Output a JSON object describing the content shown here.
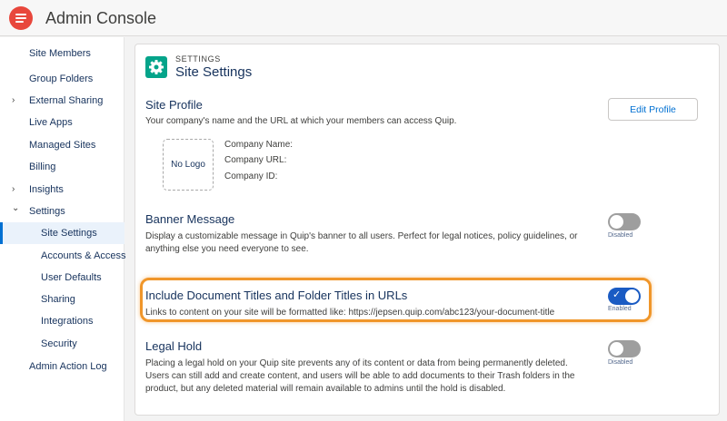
{
  "app": {
    "title": "Admin Console"
  },
  "sidebar": {
    "items": [
      {
        "label": "Site Members"
      },
      {
        "label": "Group Folders"
      },
      {
        "label": "External Sharing",
        "chevron": "›"
      },
      {
        "label": "Live Apps"
      },
      {
        "label": "Managed Sites"
      },
      {
        "label": "Billing"
      },
      {
        "label": "Insights",
        "chevron": "›"
      },
      {
        "label": "Settings",
        "chevron": "⌄"
      },
      {
        "label": "Site Settings"
      },
      {
        "label": "Accounts & Access"
      },
      {
        "label": "User Defaults"
      },
      {
        "label": "Sharing"
      },
      {
        "label": "Integrations"
      },
      {
        "label": "Security"
      },
      {
        "label": "Admin Action Log"
      }
    ]
  },
  "page": {
    "eyebrow": "SETTINGS",
    "title": "Site Settings",
    "icon": "gear-icon"
  },
  "site_profile": {
    "title": "Site Profile",
    "description": "Your company's name and the URL at which your members can access Quip.",
    "edit_button": "Edit Profile",
    "no_logo": "No Logo",
    "company_name_label": "Company Name:",
    "company_url_label": "Company URL:",
    "company_id_label": "Company ID:"
  },
  "banner_message": {
    "title": "Banner Message",
    "description": "Display a customizable message in Quip's banner to all users. Perfect for legal notices, policy guidelines, or anything else you need everyone to see.",
    "toggle_state": "Disabled"
  },
  "include_titles": {
    "title": "Include Document Titles and Folder Titles in URLs",
    "description": "Links to content on your site will be formatted like: https://jepsen.quip.com/abc123/your-document-title",
    "toggle_state": "Enabled",
    "check_glyph": "✓"
  },
  "legal_hold": {
    "title": "Legal Hold",
    "description": "Placing a legal hold on your Quip site prevents any of its content or data from being permanently deleted. Users can still add and create content, and users will be able to add documents to their Trash folders in the product, but any deleted material will remain available to admins until the hold is disabled.",
    "toggle_state": "Disabled"
  },
  "colors": {
    "accent": "#0070d2",
    "brand": "#e8473c",
    "settings_icon_bg": "#04a48a",
    "toggle_on": "#1a5bc3",
    "highlight": "#f0962a"
  }
}
